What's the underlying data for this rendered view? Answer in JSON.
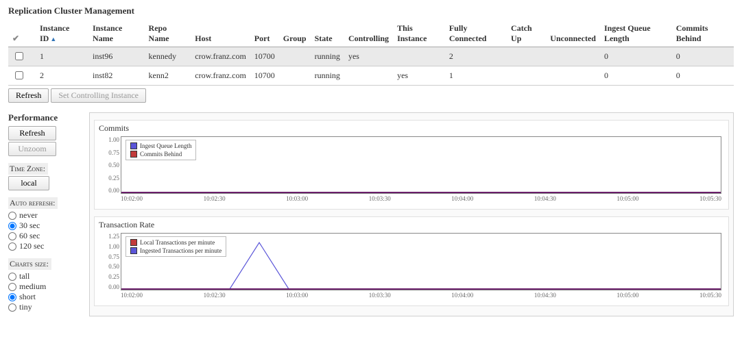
{
  "title": "Replication Cluster Management",
  "columns": {
    "instance_id": "Instance ID",
    "instance_name": "Instance Name",
    "repo_name": "Repo Name",
    "host": "Host",
    "port": "Port",
    "group": "Group",
    "state": "State",
    "controlling": "Controlling",
    "this_instance": "This Instance",
    "fully_connected": "Fully Connected",
    "catch_up": "Catch Up",
    "unconnected": "Unconnected",
    "ingest_queue_length": "Ingest Queue Length",
    "commits_behind": "Commits Behind"
  },
  "rows": [
    {
      "id": "1",
      "name": "inst96",
      "repo": "kennedy",
      "host": "crow.franz.com",
      "port": "10700",
      "group": "",
      "state": "running",
      "controlling": "yes",
      "this": "",
      "fully": "2",
      "catch": "",
      "uncon": "",
      "iql": "0",
      "cb": "0"
    },
    {
      "id": "2",
      "name": "inst82",
      "repo": "kenn2",
      "host": "crow.franz.com",
      "port": "10700",
      "group": "",
      "state": "running",
      "controlling": "",
      "this": "yes",
      "fully": "1",
      "catch": "",
      "uncon": "",
      "iql": "0",
      "cb": "0"
    }
  ],
  "buttons": {
    "refresh": "Refresh",
    "set_controlling": "Set Controlling Instance",
    "perf_refresh": "Refresh",
    "unzoom": "Unzoom",
    "tz": "local"
  },
  "sidebar": {
    "perf_heading": "Performance",
    "tz_label": "Time Zone:",
    "auto_label": "Auto refresh:",
    "auto_opts": {
      "never": "never",
      "30": "30 sec",
      "60": "60 sec",
      "120": "120 sec"
    },
    "size_label": "Charts size:",
    "size_opts": {
      "tall": "tall",
      "medium": "medium",
      "short": "short",
      "tiny": "tiny"
    }
  },
  "chart_data": [
    {
      "type": "line",
      "title": "Commits",
      "ylim": [
        0,
        1
      ],
      "yticks": [
        "1.00",
        "0.75",
        "0.50",
        "0.25",
        "0.00"
      ],
      "xticks": [
        "10:02:00",
        "10:02:30",
        "10:03:00",
        "10:03:30",
        "10:04:00",
        "10:04:30",
        "10:05:00",
        "10:05:30"
      ],
      "series": [
        {
          "name": "Ingest Queue Length",
          "color": "#5a55d8",
          "values": [
            0,
            0,
            0,
            0,
            0,
            0,
            0,
            0
          ]
        },
        {
          "name": "Commits Behind",
          "color": "#c23b3b",
          "values": [
            0,
            0,
            0,
            0,
            0,
            0,
            0,
            0
          ]
        }
      ]
    },
    {
      "type": "line",
      "title": "Transaction Rate",
      "ylim": [
        0,
        1.25
      ],
      "yticks": [
        "1.25",
        "1.00",
        "0.75",
        "0.50",
        "0.25",
        "0.00"
      ],
      "xticks": [
        "10:02:00",
        "10:02:30",
        "10:03:00",
        "10:03:30",
        "10:04:00",
        "10:04:30",
        "10:05:00",
        "10:05:30"
      ],
      "series": [
        {
          "name": "Local Transactions per minute",
          "color": "#c23b3b",
          "values": [
            0,
            0,
            0,
            0,
            0,
            0,
            0,
            0
          ]
        },
        {
          "name": "Ingested Transactions per minute",
          "color": "#5a55d8",
          "values": [
            0,
            0,
            0,
            1.05,
            0,
            0,
            0,
            0
          ],
          "peak": {
            "x_frac_start": 0.18,
            "x_frac_peak": 0.23,
            "x_frac_end": 0.28,
            "y_frac": 0.84
          }
        }
      ]
    }
  ]
}
